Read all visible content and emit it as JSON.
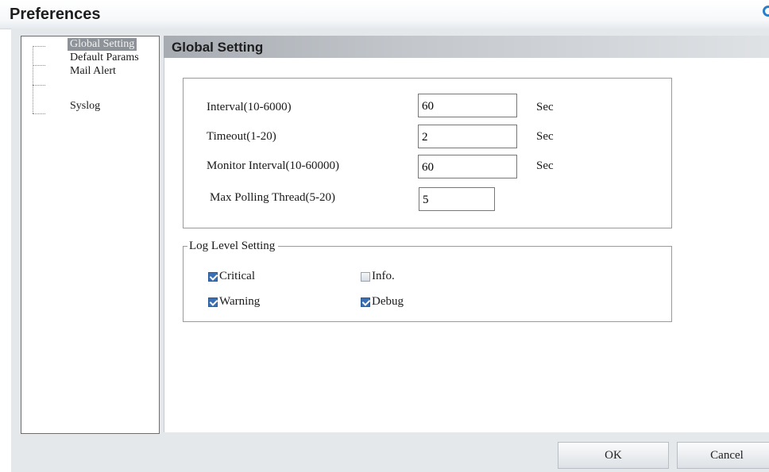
{
  "window": {
    "title": "Preferences"
  },
  "sidebar": {
    "items": [
      {
        "label": "Global Setting",
        "selected": true
      },
      {
        "label": "Default Params",
        "selected": false
      },
      {
        "label": "Mail Alert",
        "selected": false
      },
      {
        "label": "Syslog",
        "selected": false
      }
    ]
  },
  "section": {
    "title": "Global Setting"
  },
  "fields": [
    {
      "label": "Interval(10-6000)",
      "value": "60",
      "unit": "Sec"
    },
    {
      "label": "Timeout(1-20)",
      "value": "2",
      "unit": "Sec"
    },
    {
      "label": "Monitor Interval(10-60000)",
      "value": "60",
      "unit": "Sec"
    },
    {
      "label": "Max Polling Thread(5-20)",
      "value": "5",
      "unit": ""
    }
  ],
  "log_level": {
    "legend": "Log Level Setting",
    "options": [
      {
        "label": "Critical",
        "checked": true
      },
      {
        "label": "Info.",
        "checked": false
      },
      {
        "label": "Warning",
        "checked": true
      },
      {
        "label": "Debug",
        "checked": true
      }
    ]
  },
  "buttons": {
    "ok": "OK",
    "cancel": "Cancel"
  },
  "colors": {
    "accent": "#3b6fb2",
    "selection": "#8e939a",
    "help_icon": "#2a7fc8"
  }
}
